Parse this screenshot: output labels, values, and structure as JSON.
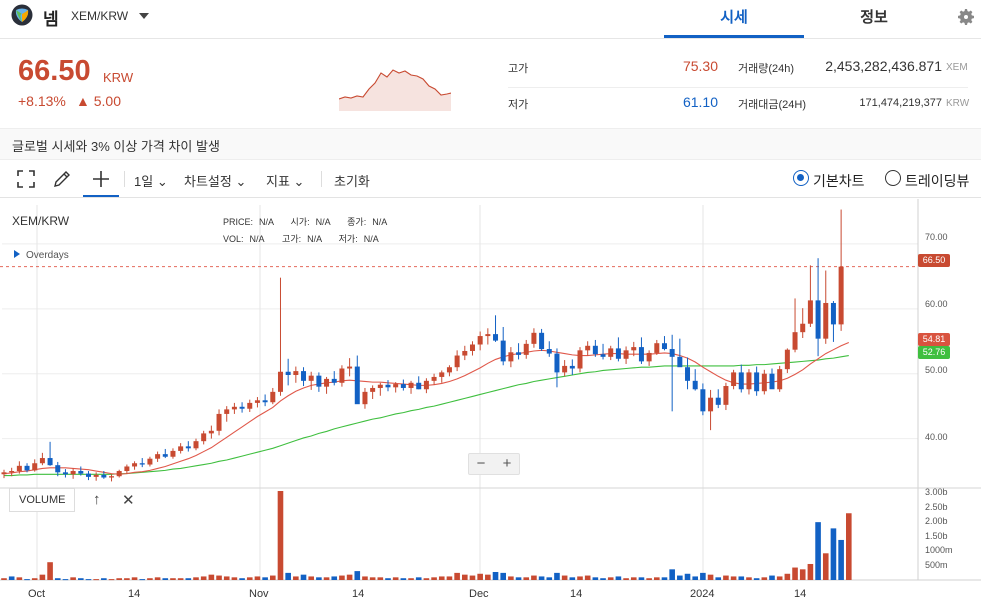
{
  "header": {
    "coin_name": "넴",
    "pair": "XEM/KRW",
    "tabs": [
      {
        "label": "시세",
        "active": true
      },
      {
        "label": "정보",
        "active": false
      }
    ]
  },
  "ticker": {
    "price": "66.50",
    "unit": "KRW",
    "change_pct": "+8.13%",
    "change_abs": "▲ 5.00",
    "high_label": "고가",
    "high_value": "75.30",
    "low_label": "저가",
    "low_value": "61.10",
    "volume_label": "거래량(24h)",
    "volume_value": "2,453,282,436.871",
    "volume_unit": "XEM",
    "turnover_label": "거래대금(24H)",
    "turnover_value": "171,474,219,377",
    "turnover_unit": "KRW"
  },
  "notice": "글로벌 시세와 3% 이상 가격 차이 발생",
  "toolbar": {
    "interval": "1일",
    "chart_settings": "차트설정",
    "indicators": "지표",
    "reset": "초기화",
    "radio_basic": "기본차트",
    "radio_trading": "트레이딩뷰"
  },
  "chart_panel": {
    "symbol": "XEM/KRW",
    "ohlc": {
      "price_label": "PRICE:",
      "price": "N/A",
      "open_label": "시가:",
      "open": "N/A",
      "close_label": "종가:",
      "close": "N/A",
      "vol_label": "VOL:",
      "vol": "N/A",
      "high_label": "고가:",
      "high": "N/A",
      "low_label": "저가:",
      "low": "N/A"
    },
    "overlay_label": "Overdays",
    "zoom_out": "−",
    "zoom_in": "+",
    "volume_label": "VOLUME",
    "volume_up": "↑",
    "volume_close": "✕",
    "current_tag": "66.50",
    "ma_tag_1": "54.81",
    "ma_tag_2": "52.76",
    "price_axis": [
      "70.00",
      "60.00",
      "50.00",
      "40.00"
    ],
    "volume_axis": [
      "3.00b",
      "2.50b",
      "2.00b",
      "1.50b",
      "1000m",
      "500m"
    ],
    "x_axis": [
      "Oct",
      "14",
      "Nov",
      "14",
      "Dec",
      "14",
      "2024",
      "14"
    ],
    "colors": {
      "up": "#c84a31",
      "down": "#1261c4",
      "ma_short": "#e0584a",
      "ma_long": "#3fbf3f"
    }
  },
  "chart_data": {
    "type": "candlestick",
    "candles": [
      [
        34.5,
        35.2,
        33.9,
        34.8
      ],
      [
        34.8,
        35.5,
        34.2,
        35.0
      ],
      [
        35.0,
        36.5,
        34.6,
        35.8
      ],
      [
        35.8,
        36.2,
        34.8,
        35.1
      ],
      [
        35.1,
        36.8,
        34.9,
        36.2
      ],
      [
        36.2,
        37.8,
        35.9,
        37.0
      ],
      [
        37.0,
        39.5,
        35.8,
        35.9
      ],
      [
        35.9,
        36.4,
        34.2,
        34.8
      ],
      [
        34.8,
        35.3,
        34.0,
        34.5
      ],
      [
        34.5,
        35.4,
        33.8,
        35.0
      ],
      [
        35.0,
        35.7,
        34.3,
        34.6
      ],
      [
        34.6,
        35.0,
        33.6,
        34.1
      ],
      [
        34.1,
        34.8,
        33.5,
        34.4
      ],
      [
        34.4,
        35.0,
        33.8,
        34.0
      ],
      [
        34.0,
        34.5,
        33.4,
        34.2
      ],
      [
        34.2,
        35.2,
        34.0,
        35.0
      ],
      [
        35.0,
        36.0,
        34.6,
        35.7
      ],
      [
        35.7,
        36.5,
        35.2,
        36.2
      ],
      [
        36.2,
        37.0,
        35.6,
        36.0
      ],
      [
        36.0,
        37.2,
        35.7,
        36.9
      ],
      [
        36.9,
        38.0,
        36.4,
        37.6
      ],
      [
        37.6,
        38.4,
        37.0,
        37.2
      ],
      [
        37.2,
        38.5,
        36.9,
        38.1
      ],
      [
        38.1,
        39.3,
        37.7,
        38.8
      ],
      [
        38.8,
        39.6,
        38.0,
        38.5
      ],
      [
        38.5,
        40.0,
        38.2,
        39.6
      ],
      [
        39.6,
        41.2,
        39.1,
        40.8
      ],
      [
        40.8,
        42.0,
        40.0,
        41.2
      ],
      [
        41.2,
        44.5,
        40.5,
        43.8
      ],
      [
        43.8,
        45.0,
        42.6,
        44.5
      ],
      [
        44.5,
        45.5,
        43.8,
        44.9
      ],
      [
        44.9,
        45.6,
        44.0,
        44.6
      ],
      [
        44.6,
        46.0,
        44.1,
        45.5
      ],
      [
        45.5,
        46.4,
        44.8,
        45.9
      ],
      [
        45.9,
        46.8,
        45.0,
        45.6
      ],
      [
        45.6,
        47.8,
        45.3,
        47.2
      ],
      [
        47.2,
        64.8,
        46.6,
        50.3
      ],
      [
        50.3,
        52.3,
        48.2,
        49.8
      ],
      [
        49.8,
        51.1,
        48.6,
        50.4
      ],
      [
        50.4,
        51.0,
        48.1,
        48.9
      ],
      [
        48.9,
        50.3,
        47.5,
        49.7
      ],
      [
        49.7,
        50.2,
        47.2,
        48.0
      ],
      [
        48.0,
        49.5,
        46.9,
        49.2
      ],
      [
        49.2,
        50.4,
        48.2,
        48.6
      ],
      [
        48.6,
        51.3,
        48.0,
        50.8
      ],
      [
        50.8,
        52.4,
        49.6,
        51.1
      ],
      [
        51.1,
        52.8,
        45.6,
        45.3
      ],
      [
        45.3,
        47.8,
        44.6,
        47.2
      ],
      [
        47.2,
        48.2,
        46.1,
        47.8
      ],
      [
        47.8,
        48.6,
        46.6,
        48.3
      ],
      [
        48.3,
        49.0,
        47.3,
        47.9
      ],
      [
        47.9,
        48.7,
        47.1,
        48.4
      ],
      [
        48.4,
        49.1,
        47.4,
        47.8
      ],
      [
        47.8,
        48.9,
        46.9,
        48.6
      ],
      [
        48.6,
        49.6,
        47.6,
        47.6
      ],
      [
        47.6,
        49.3,
        47.0,
        48.9
      ],
      [
        48.9,
        50.0,
        48.3,
        49.5
      ],
      [
        49.5,
        50.5,
        48.6,
        50.2
      ],
      [
        50.2,
        51.3,
        49.6,
        51.0
      ],
      [
        51.0,
        53.6,
        50.4,
        52.8
      ],
      [
        52.8,
        54.3,
        52.1,
        53.5
      ],
      [
        53.5,
        55.0,
        52.8,
        54.5
      ],
      [
        54.5,
        56.5,
        53.6,
        55.8
      ],
      [
        55.8,
        57.0,
        54.5,
        56.1
      ],
      [
        56.1,
        59.0,
        54.9,
        55.1
      ],
      [
        55.1,
        57.2,
        51.3,
        51.9
      ],
      [
        51.9,
        54.1,
        51.0,
        53.3
      ],
      [
        53.3,
        54.7,
        52.2,
        52.9
      ],
      [
        52.9,
        55.2,
        52.3,
        54.6
      ],
      [
        54.6,
        57.0,
        54.0,
        56.3
      ],
      [
        56.3,
        56.9,
        53.5,
        53.8
      ],
      [
        53.8,
        55.0,
        52.6,
        53.1
      ],
      [
        53.1,
        53.9,
        47.9,
        50.2
      ],
      [
        50.2,
        52.1,
        49.6,
        51.2
      ],
      [
        51.2,
        52.2,
        49.8,
        50.8
      ],
      [
        50.8,
        54.1,
        50.2,
        53.6
      ],
      [
        53.6,
        55.0,
        52.8,
        54.3
      ],
      [
        54.3,
        55.2,
        52.6,
        53.0
      ],
      [
        53.0,
        54.6,
        52.2,
        52.6
      ],
      [
        52.6,
        54.3,
        52.1,
        53.9
      ],
      [
        53.9,
        55.6,
        51.9,
        52.3
      ],
      [
        52.3,
        54.2,
        51.5,
        53.6
      ],
      [
        53.6,
        54.9,
        52.7,
        54.1
      ],
      [
        54.1,
        55.6,
        51.5,
        51.9
      ],
      [
        51.9,
        53.6,
        51.2,
        53.2
      ],
      [
        53.2,
        55.2,
        52.9,
        54.7
      ],
      [
        54.7,
        55.8,
        53.6,
        53.8
      ],
      [
        53.8,
        56.0,
        44.2,
        52.6
      ],
      [
        52.6,
        55.4,
        51.2,
        51.0
      ],
      [
        51.0,
        52.5,
        47.6,
        48.9
      ],
      [
        48.9,
        50.7,
        47.4,
        47.6
      ],
      [
        47.6,
        48.5,
        43.6,
        44.2
      ],
      [
        44.2,
        47.5,
        41.3,
        46.3
      ],
      [
        46.3,
        47.6,
        44.7,
        45.2
      ],
      [
        45.2,
        48.6,
        44.4,
        48.1
      ],
      [
        48.1,
        50.6,
        47.6,
        50.2
      ],
      [
        50.2,
        51.4,
        47.1,
        47.6
      ],
      [
        47.6,
        50.7,
        46.8,
        50.2
      ],
      [
        50.2,
        51.1,
        46.6,
        47.3
      ],
      [
        47.3,
        50.6,
        46.8,
        50.0
      ],
      [
        50.0,
        50.8,
        47.7,
        47.6
      ],
      [
        47.6,
        51.2,
        47.2,
        50.7
      ],
      [
        50.7,
        53.9,
        50.1,
        53.7
      ],
      [
        53.7,
        61.6,
        53.3,
        56.4
      ],
      [
        56.4,
        60.1,
        55.5,
        57.7
      ],
      [
        57.7,
        66.7,
        57.2,
        61.3
      ],
      [
        61.3,
        67.8,
        52.7,
        55.4
      ],
      [
        55.4,
        65.9,
        54.6,
        60.9
      ],
      [
        60.9,
        61.2,
        54.9,
        57.6
      ],
      [
        57.6,
        75.3,
        56.6,
        66.5
      ]
    ],
    "volume_relative": [
      2,
      4,
      3,
      1,
      2,
      6,
      20,
      2,
      1,
      3,
      2,
      1,
      1,
      2,
      1,
      2,
      2,
      3,
      1,
      2,
      3,
      2,
      2,
      2,
      2,
      3,
      4,
      6,
      5,
      4,
      3,
      2,
      3,
      4,
      3,
      5,
      100,
      8,
      4,
      6,
      4,
      3,
      3,
      4,
      5,
      6,
      10,
      4,
      3,
      3,
      2,
      3,
      2,
      2,
      3,
      2,
      3,
      4,
      4,
      8,
      6,
      5,
      7,
      6,
      9,
      8,
      4,
      3,
      3,
      5,
      4,
      3,
      8,
      5,
      3,
      4,
      5,
      3,
      2,
      3,
      4,
      2,
      3,
      3,
      2,
      3,
      3,
      12,
      5,
      7,
      4,
      8,
      6,
      3,
      5,
      4,
      4,
      3,
      2,
      3,
      5,
      4,
      7,
      14,
      12,
      18,
      65,
      30,
      58,
      45,
      75
    ],
    "volume_up": [
      1,
      0,
      1,
      0,
      1,
      1,
      1,
      0,
      0,
      1,
      0,
      0,
      1,
      0,
      1,
      1,
      1,
      1,
      0,
      1,
      1,
      0,
      1,
      1,
      0,
      1,
      1,
      1,
      1,
      1,
      1,
      0,
      1,
      1,
      0,
      1,
      1,
      0,
      1,
      0,
      1,
      0,
      1,
      0,
      1,
      1,
      0,
      1,
      1,
      1,
      0,
      1,
      0,
      1,
      0,
      1,
      1,
      1,
      1,
      1,
      1,
      1,
      1,
      1,
      0,
      0,
      1,
      0,
      1,
      1,
      0,
      0,
      0,
      1,
      0,
      1,
      1,
      0,
      0,
      1,
      0,
      1,
      1,
      0,
      1,
      1,
      0,
      0,
      0,
      0,
      0,
      0,
      1,
      0,
      1,
      1,
      0,
      1,
      0,
      1,
      0,
      1,
      1,
      1,
      1,
      1,
      0,
      1,
      0,
      0,
      1
    ],
    "ylim": [
      33,
      76
    ],
    "ma_short": [
      34.6,
      34.7,
      34.9,
      35.0,
      35.2,
      35.4,
      35.5,
      35.5,
      35.5,
      35.4,
      35.3,
      35.2,
      35.0,
      34.8,
      34.6,
      34.5,
      34.6,
      34.8,
      34.9,
      35.1,
      35.4,
      35.7,
      36.1,
      36.5,
      36.9,
      37.4,
      38.0,
      38.6,
      39.4,
      40.2,
      41.0,
      41.8,
      42.6,
      43.4,
      44.1,
      44.8,
      45.8,
      46.6,
      47.3,
      47.8,
      48.2,
      48.4,
      48.6,
      48.7,
      48.9,
      49.0,
      48.9,
      48.8,
      48.7,
      48.7,
      48.6,
      48.5,
      48.4,
      48.3,
      48.2,
      48.2,
      48.3,
      48.5,
      48.8,
      49.2,
      49.7,
      50.3,
      50.9,
      51.6,
      52.2,
      52.6,
      52.9,
      53.1,
      53.3,
      53.5,
      53.6,
      53.5,
      53.3,
      53.1,
      52.9,
      52.8,
      52.8,
      52.9,
      53.0,
      53.1,
      53.1,
      53.0,
      53.0,
      53.0,
      53.0,
      53.1,
      53.2,
      53.1,
      52.8,
      52.4,
      51.8,
      51.0,
      50.3,
      49.6,
      49.0,
      48.6,
      48.4,
      48.4,
      48.5,
      48.6,
      48.7,
      48.9,
      49.3,
      49.9,
      50.6,
      51.5,
      52.3,
      53.1,
      53.7,
      54.3,
      54.8
    ],
    "ma_long": [
      34.3,
      34.3,
      34.4,
      34.4,
      34.5,
      34.5,
      34.5,
      34.5,
      34.5,
      34.5,
      34.5,
      34.5,
      34.5,
      34.5,
      34.5,
      34.6,
      34.6,
      34.7,
      34.8,
      34.9,
      35.0,
      35.1,
      35.3,
      35.4,
      35.6,
      35.8,
      36.0,
      36.2,
      36.5,
      36.7,
      37.0,
      37.3,
      37.6,
      37.9,
      38.2,
      38.5,
      38.9,
      39.3,
      39.7,
      40.1,
      40.4,
      40.8,
      41.1,
      41.5,
      41.8,
      42.1,
      42.4,
      42.7,
      43.0,
      43.2,
      43.5,
      43.8,
      44.0,
      44.3,
      44.5,
      44.8,
      45.0,
      45.3,
      45.6,
      45.9,
      46.2,
      46.5,
      46.8,
      47.1,
      47.4,
      47.7,
      48.0,
      48.3,
      48.5,
      48.8,
      49.0,
      49.2,
      49.4,
      49.6,
      49.8,
      50.0,
      50.2,
      50.3,
      50.5,
      50.6,
      50.7,
      50.8,
      50.9,
      51.0,
      51.0,
      51.1,
      51.2,
      51.2,
      51.2,
      51.2,
      51.2,
      51.2,
      51.2,
      51.2,
      51.2,
      51.2,
      51.3,
      51.3,
      51.4,
      51.4,
      51.5,
      51.6,
      51.7,
      51.8,
      51.9,
      52.0,
      52.1,
      52.3,
      52.4,
      52.6,
      52.8
    ]
  }
}
